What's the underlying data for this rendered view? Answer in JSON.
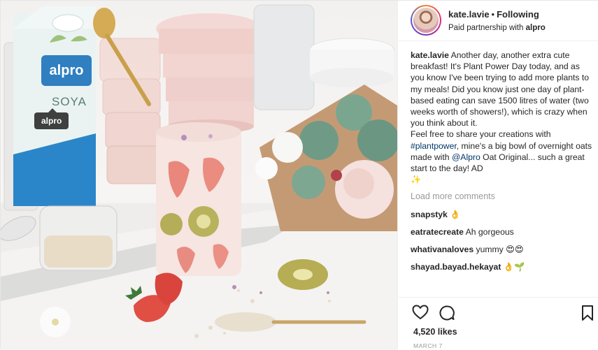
{
  "photo": {
    "alt_subject": "breakfast flat lay",
    "tag": "alpro",
    "carton_brand": "alpro",
    "carton_variant": "SOYA"
  },
  "header": {
    "username": "kate.lavie",
    "separator": "•",
    "follow_status": "Following",
    "partnership_prefix": "Paid partnership with",
    "partner_name": "alpro"
  },
  "caption": {
    "username": "kate.lavie",
    "text_1": "Another day, another extra cute breakfast! It's Plant Power Day today, and as you know I've been trying to add more plants to my meals! Did you know just one day of plant-based eating can save 1500 litres of water (two weeks worth of showers!), which is crazy when you think about it.",
    "text_2": "Feel free to share your creations with",
    "hashtag": "#plantpower",
    "text_3": ", mine's a big bowl of overnight oats made with",
    "mention": "@Alpro",
    "text_4": "Oat Original... such a great start to the day! AD",
    "sparkle": "✨"
  },
  "load_more": "Load more comments",
  "comments": [
    {
      "user": "snapstyk",
      "text": "👌"
    },
    {
      "user": "eatratecreate",
      "text": "Ah gorgeous"
    },
    {
      "user": "whativanaloves",
      "text": "yummy 😍😍"
    },
    {
      "user": "shayad.bayad.hekayat",
      "text": "👌🌱"
    }
  ],
  "likes": "4,520 likes",
  "date": "MARCH 7",
  "icons": {
    "like": "heart-icon",
    "comment": "comment-icon",
    "save": "bookmark-icon"
  },
  "colors": {
    "text": "#262626",
    "link": "#003569",
    "muted": "#999999",
    "border": "#efefef"
  }
}
